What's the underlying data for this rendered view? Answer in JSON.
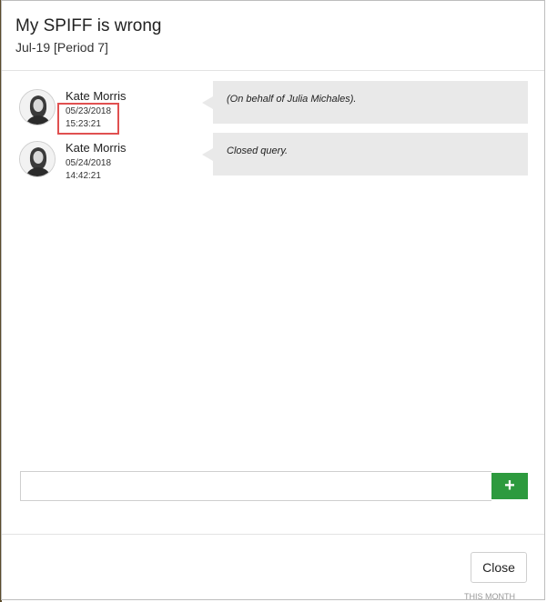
{
  "dialog": {
    "title": "My SPIFF is wrong",
    "subtitle": "Jul-19 [Period 7]"
  },
  "messages": [
    {
      "author": "Kate Morris",
      "date": "05/23/2018",
      "time": "15:23:21",
      "text": "(On behalf of Julia Michales)."
    },
    {
      "author": "Kate Morris",
      "date": "05/24/2018",
      "time": "14:42:21",
      "text": "Closed query."
    }
  ],
  "composer": {
    "value": "",
    "add_icon": "+"
  },
  "footer": {
    "close_label": "Close"
  },
  "background_fragment": "THIS MONTH",
  "colors": {
    "accent_green": "#2d9a3e",
    "highlight_red": "#e05050",
    "bubble_gray": "#e9e9e9"
  }
}
